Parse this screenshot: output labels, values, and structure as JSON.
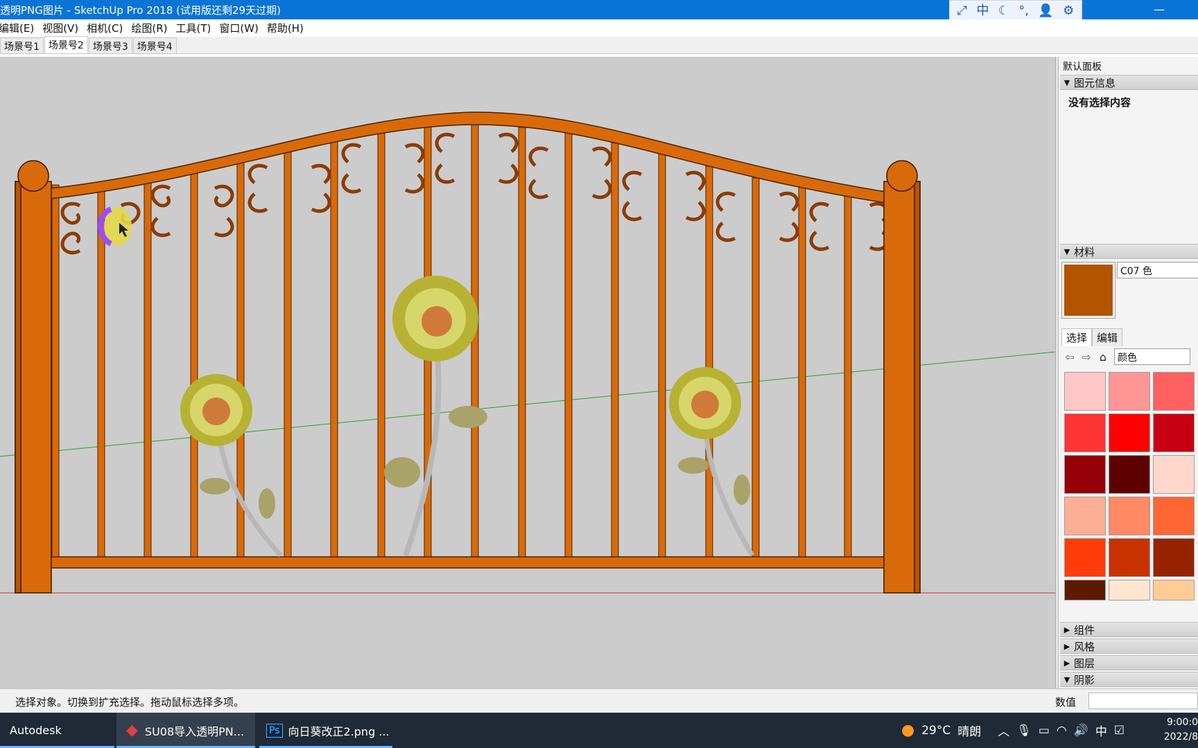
{
  "window": {
    "title": "透明PNG图片 - SketchUp Pro 2018   (试用版还剩29天过期)",
    "ime_icons": [
      "expand-icon",
      "中",
      "moon-icon",
      "punctuation-icon",
      "user-icon",
      "gear-icon"
    ],
    "ime_chinese_label": "中",
    "minimize_label": "—"
  },
  "menu": {
    "items": [
      "编辑(E)",
      "视图(V)",
      "相机(C)",
      "绘图(R)",
      "工具(T)",
      "窗口(W)",
      "帮助(H)"
    ]
  },
  "scenes": {
    "tabs": [
      "场景号1",
      "场景号2",
      "场景号3",
      "场景号4"
    ],
    "active_index": 1
  },
  "viewport": {
    "background": "#cccccc",
    "fence_color": "#d96a0a",
    "axis_green": "#2aa02a",
    "axis_red": "#d23030"
  },
  "panel": {
    "title": "默认面板",
    "entity_info": {
      "header": "图元信息",
      "empty_text": "没有选择内容"
    },
    "materials": {
      "header": "材料",
      "name": "C07 色",
      "swatch_color": "#b35400",
      "tabs": [
        "选择",
        "编辑"
      ],
      "library": "颜色",
      "colors": [
        "#ffc7c7",
        "#ff9696",
        "#ff6161",
        "#ff3535",
        "#ff0000",
        "#c80014",
        "#960008",
        "#5e0000",
        "#ffd7cb",
        "#ffae96",
        "#ff8a63",
        "#ff6633",
        "#ff3c0a",
        "#c83200",
        "#962300",
        "#5e1a00",
        "#ffe6d2",
        "#ffcc96"
      ]
    },
    "collapsed_sections": [
      "组件",
      "风格",
      "图层"
    ],
    "expanded_tail": "阴影"
  },
  "status": {
    "text": "选择对象。切换到扩充选择。拖动鼠标选择多项。",
    "value_label": "数值"
  },
  "taskbar": {
    "items": [
      "Autodesk",
      "SU08导入透明PN...",
      "向日葵改正2.png ..."
    ],
    "weather_temp": "29°C",
    "weather_text": "晴朗",
    "ime": "中",
    "time": "9:00:0",
    "date": "2022/8"
  }
}
